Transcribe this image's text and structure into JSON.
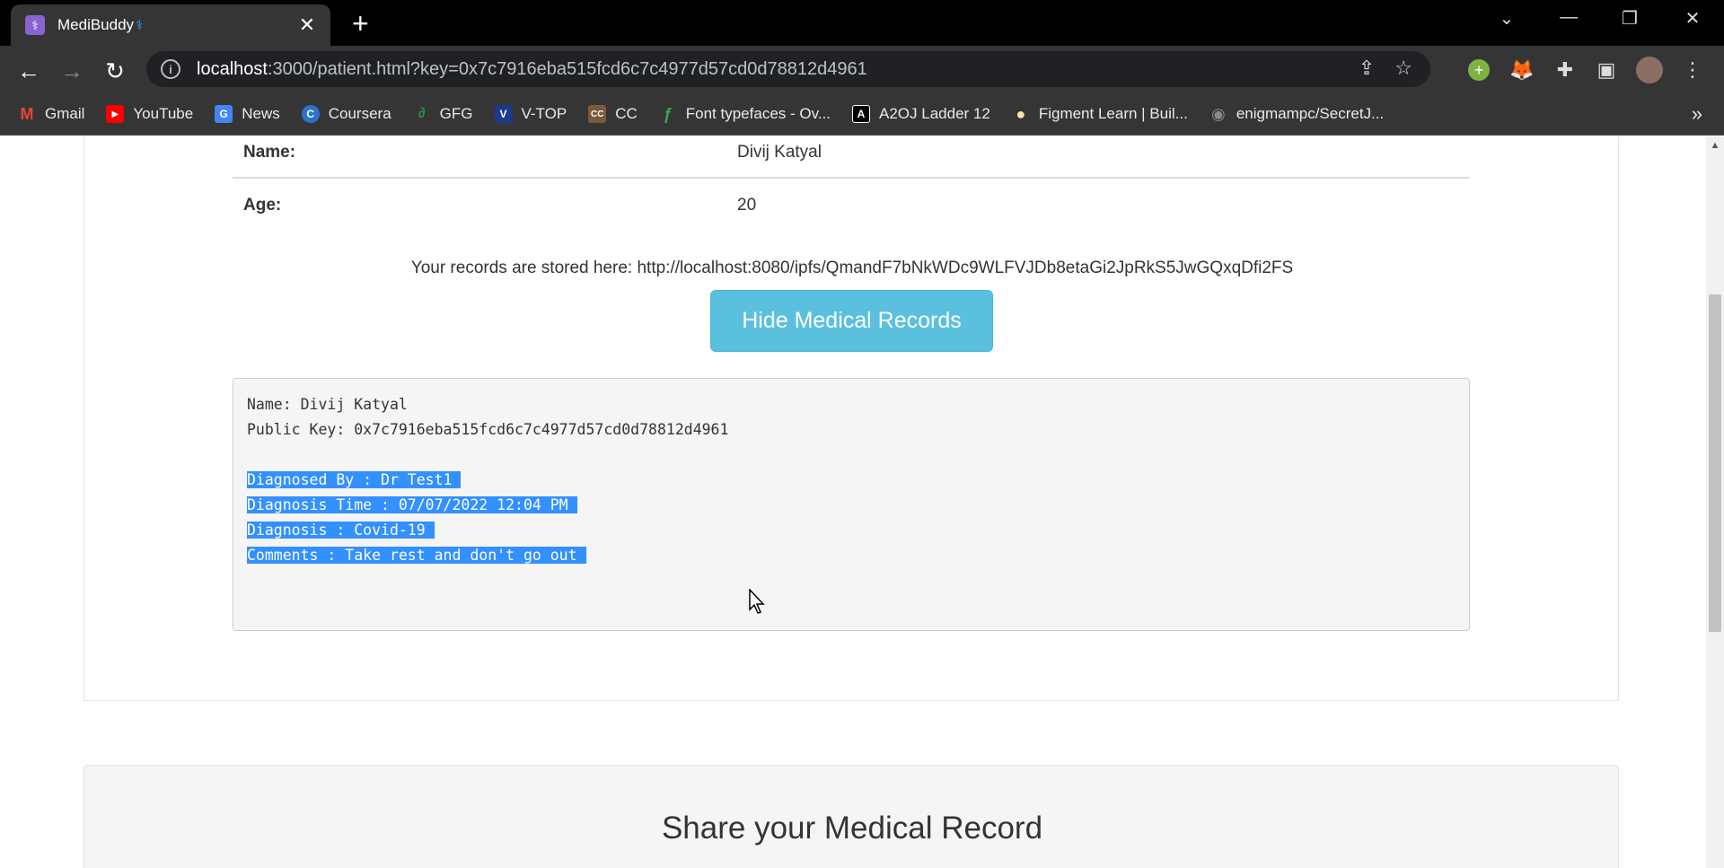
{
  "browser": {
    "tab": {
      "title": "MediBuddy",
      "badge": "⚕",
      "favicon": "⚕"
    },
    "address": {
      "host": "localhost",
      "rest": ":3000/patient.html?key=0x7c7916eba515fcd6c7c4977d57cd0d78812d4961"
    },
    "bookmarks": [
      {
        "label": "Gmail",
        "icon": "gmail-icon",
        "color": "#ea4335",
        "glyph": "M"
      },
      {
        "label": "YouTube",
        "icon": "youtube-icon",
        "color": "#ff0000",
        "glyph": "▶"
      },
      {
        "label": "News",
        "icon": "google-news-icon",
        "color": "#4285f4",
        "glyph": "G"
      },
      {
        "label": "Coursera",
        "icon": "coursera-icon",
        "color": "#2a73cc",
        "glyph": "C"
      },
      {
        "label": "GFG",
        "icon": "gfg-icon",
        "color": "#2f8d46",
        "glyph": "∂"
      },
      {
        "label": "V-TOP",
        "icon": "vtop-icon",
        "color": "#1a3a8a",
        "glyph": "V"
      },
      {
        "label": "CC",
        "icon": "codechef-icon",
        "color": "#7b5a3a",
        "glyph": "CC"
      },
      {
        "label": "Font typefaces - Ov...",
        "icon": "font-icon",
        "color": "#34a853",
        "glyph": "ƒ"
      },
      {
        "label": "A2OJ Ladder 12",
        "icon": "a2oj-icon",
        "color": "#000000",
        "glyph": "A"
      },
      {
        "label": "Figment Learn | Buil...",
        "icon": "figment-icon",
        "color": "#f5e6a0",
        "glyph": "●"
      },
      {
        "label": "enigmampc/SecretJ...",
        "icon": "github-icon",
        "color": "#444444",
        "glyph": "◉"
      }
    ]
  },
  "patient": {
    "name_label": "Name:",
    "name_value": "Divij Katyal",
    "age_label": "Age:",
    "age_value": "20",
    "records_text": "Your records are stored here: http://localhost:8080/ipfs/QmandF7bNkWDc9WLFVJDb8etaGi2JpRkS5JwGQxqDfi2FS",
    "hide_button": "Hide Medical Records"
  },
  "record": {
    "lines": [
      "Name: Divij Katyal",
      "Public Key: 0x7c7916eba515fcd6c7c4977d57cd0d78812d4961",
      "",
      "Diagnosed By : Dr Test1",
      "Diagnosis Time : 07/07/2022 12:04 PM",
      "Diagnosis : Covid-19",
      "Comments : Take rest and don't go out"
    ]
  },
  "share": {
    "title": "Share your Medical Record"
  }
}
